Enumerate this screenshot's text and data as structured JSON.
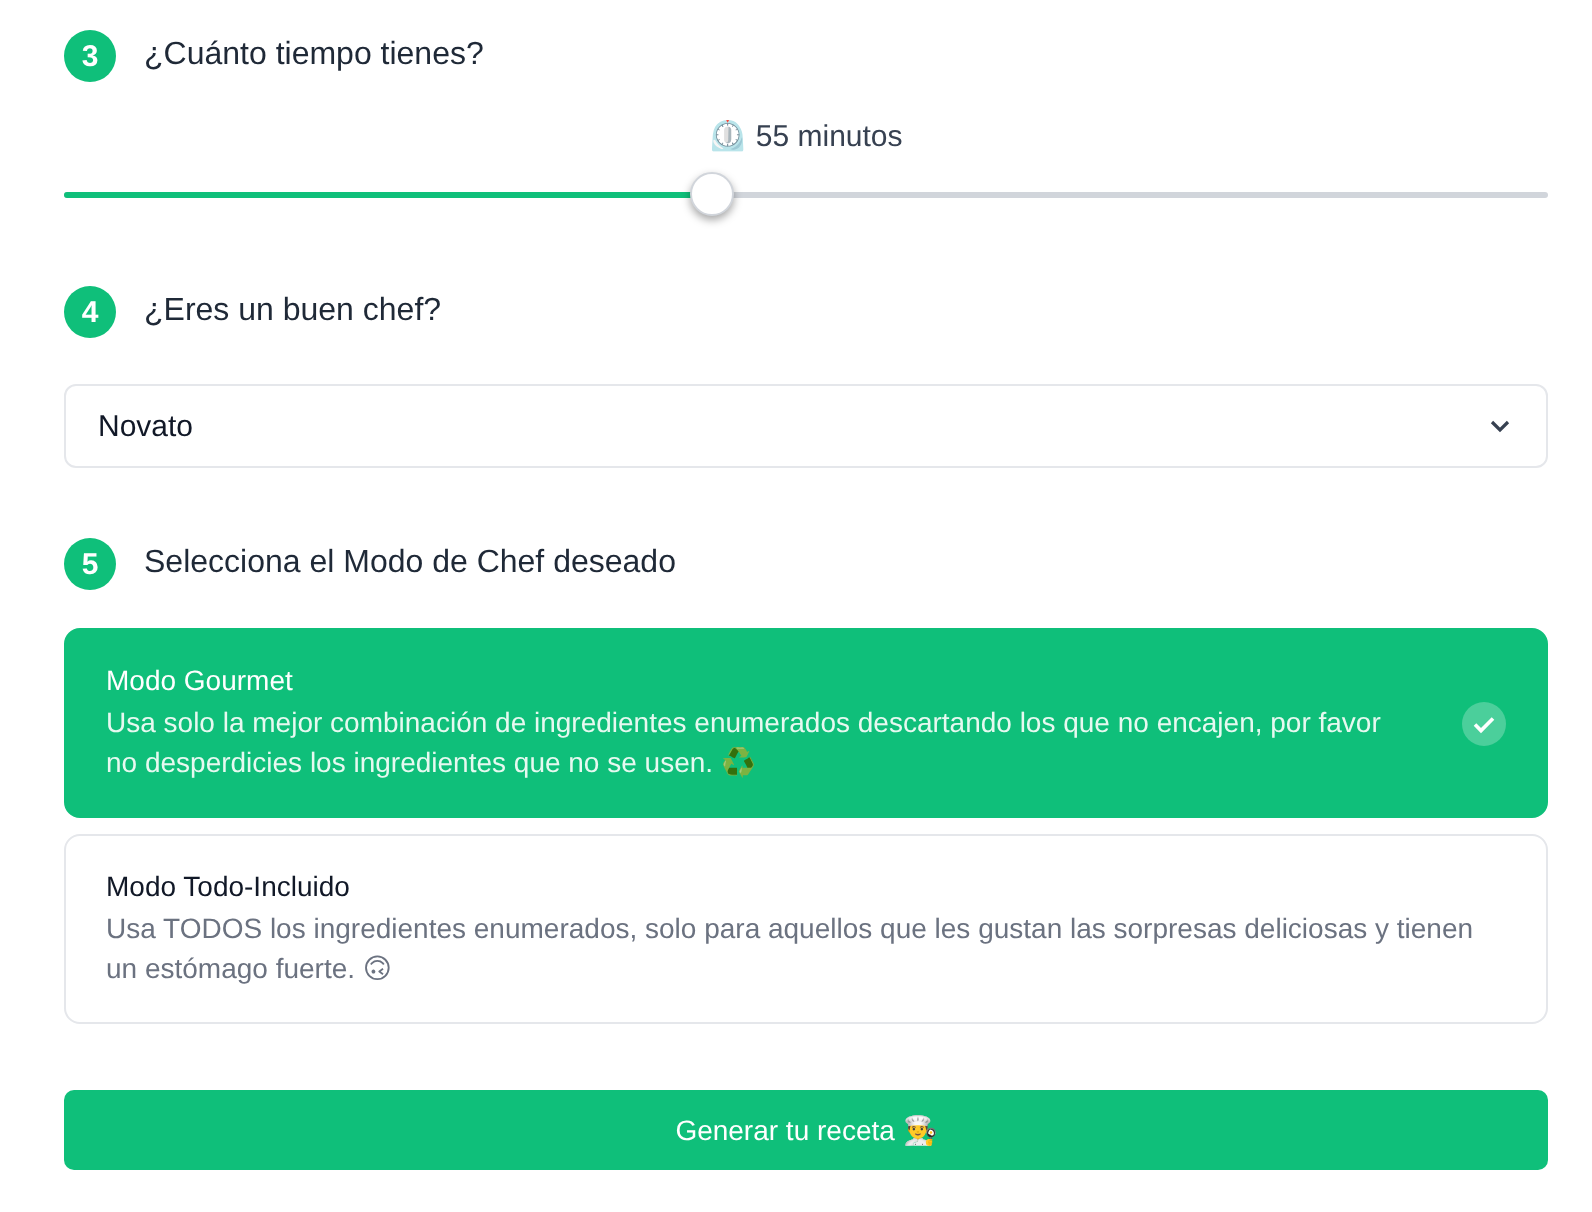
{
  "steps": [
    {
      "number": "3",
      "title": "¿Cuánto tiempo tienes?"
    },
    {
      "number": "4",
      "title": "¿Eres un buen chef?"
    },
    {
      "number": "5",
      "title": "Selecciona el Modo de Chef deseado"
    }
  ],
  "time": {
    "reading": "⏲️ 55 minutos",
    "level": 0.437
  },
  "skill": {
    "value": "Novato"
  },
  "modes": [
    {
      "title": "Modo Gourmet",
      "description": "Usa solo la mejor combinación de ingredientes enumerados descartando los que no encajen, por favor no desperdicies los ingredientes que no se usen. ♻️",
      "selected": true
    },
    {
      "title": "Modo Todo-Incluido",
      "description": "Usa TODOS los ingredientes enumerados, solo para aquellos que les gustan las sorpresas deliciosas y tienen un estómago fuerte. 🙃",
      "selected": false
    }
  ],
  "submit": "Generar tu receta 👨‍🍳"
}
